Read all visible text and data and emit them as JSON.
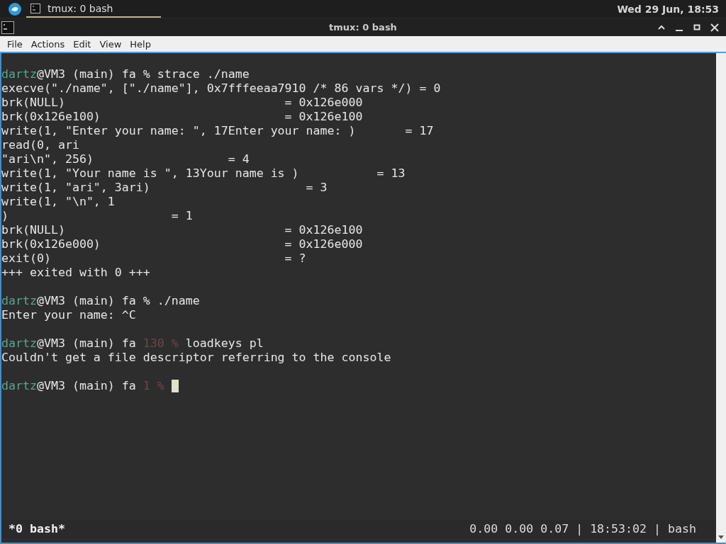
{
  "panel": {
    "tasks": [
      {
        "label": "tmux: 0 bash",
        "selected": true
      }
    ],
    "clock": "Wed 29 Jun, 18:53"
  },
  "window": {
    "title": "tmux: 0 bash"
  },
  "menu": [
    "File",
    "Actions",
    "Edit",
    "View",
    "Help"
  ],
  "terminal": {
    "blocks": [
      [
        {
          "segments": [
            {
              "kind": "user",
              "text": "dartz"
            },
            {
              "kind": "text",
              "text": "@VM3 (main) fa % strace ./name"
            }
          ]
        },
        {
          "segments": [
            {
              "kind": "text",
              "text": "execve(\"./name\", [\"./name\"], 0x7fffeeaa7910 /* 86 vars */) = 0"
            }
          ]
        },
        {
          "segments": [
            {
              "kind": "text",
              "text": "brk(NULL)                               = 0x126e000"
            }
          ]
        },
        {
          "segments": [
            {
              "kind": "text",
              "text": "brk(0x126e100)                          = 0x126e100"
            }
          ]
        },
        {
          "segments": [
            {
              "kind": "text",
              "text": "write(1, \"Enter your name: \", 17Enter your name: )       = 17"
            }
          ]
        },
        {
          "segments": [
            {
              "kind": "text",
              "text": "read(0, ari"
            }
          ]
        },
        {
          "segments": [
            {
              "kind": "text",
              "text": "\"ari\\n\", 256)                   = 4"
            }
          ]
        },
        {
          "segments": [
            {
              "kind": "text",
              "text": "write(1, \"Your name is \", 13Your name is )           = 13"
            }
          ]
        },
        {
          "segments": [
            {
              "kind": "text",
              "text": "write(1, \"ari\", 3ari)                      = 3"
            }
          ]
        },
        {
          "segments": [
            {
              "kind": "text",
              "text": "write(1, \"\\n\", 1"
            }
          ]
        },
        {
          "segments": [
            {
              "kind": "text",
              "text": ")                       = 1"
            }
          ]
        },
        {
          "segments": [
            {
              "kind": "text",
              "text": "brk(NULL)                               = 0x126e100"
            }
          ]
        },
        {
          "segments": [
            {
              "kind": "text",
              "text": "brk(0x126e000)                          = 0x126e000"
            }
          ]
        },
        {
          "segments": [
            {
              "kind": "text",
              "text": "exit(0)                                 = ?"
            }
          ]
        },
        {
          "segments": [
            {
              "kind": "text",
              "text": "+++ exited with 0 +++"
            }
          ]
        }
      ],
      [
        {
          "segments": [
            {
              "kind": "user",
              "text": "dartz"
            },
            {
              "kind": "text",
              "text": "@VM3 (main) fa % ./name"
            }
          ]
        },
        {
          "segments": [
            {
              "kind": "text",
              "text": "Enter your name: ^C"
            }
          ]
        }
      ],
      [
        {
          "segments": [
            {
              "kind": "user",
              "text": "dartz"
            },
            {
              "kind": "text",
              "text": "@VM3 (main) fa "
            },
            {
              "kind": "dim",
              "text": "130 %"
            },
            {
              "kind": "text",
              "text": " loadkeys pl"
            }
          ]
        },
        {
          "segments": [
            {
              "kind": "text",
              "text": "Couldn't get a file descriptor referring to the console"
            }
          ]
        }
      ],
      [
        {
          "segments": [
            {
              "kind": "user",
              "text": "dartz"
            },
            {
              "kind": "text",
              "text": "@VM3 (main) fa "
            },
            {
              "kind": "dim",
              "text": "1 %"
            }
          ],
          "cursor": true
        }
      ]
    ]
  },
  "status_bar": {
    "left": "*0 bash*",
    "right": "0.00 0.00 0.07 | 18:53:02 | bash"
  }
}
